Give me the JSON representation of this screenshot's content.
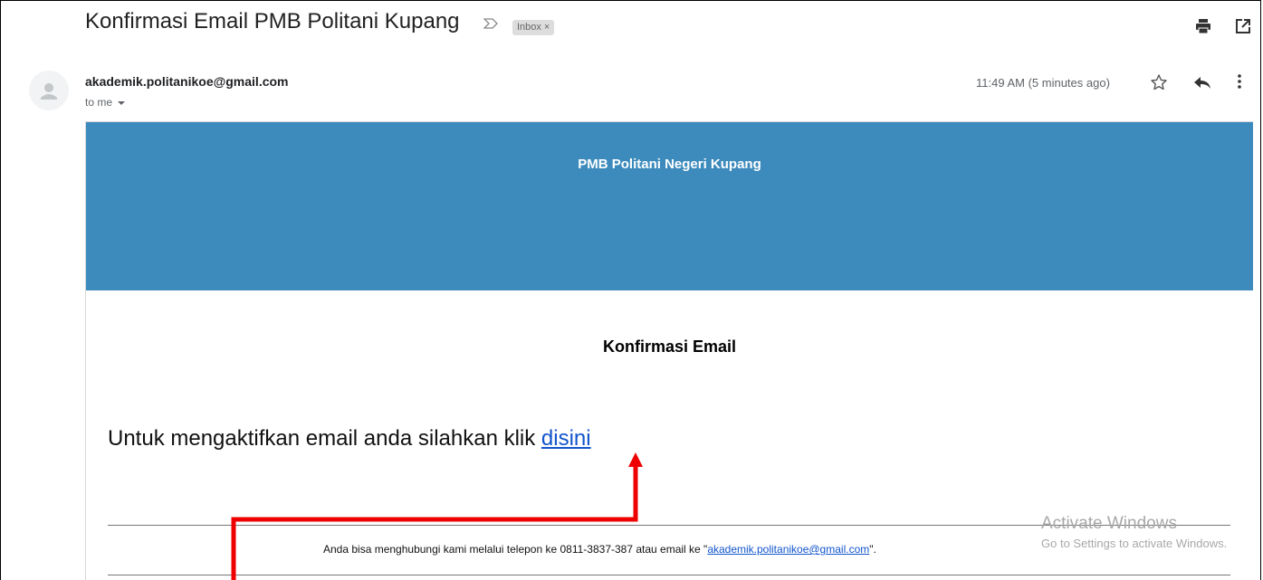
{
  "header": {
    "subject": "Konfirmasi Email PMB Politani Kupang",
    "label": "Inbox",
    "label_remove": "×"
  },
  "sender": {
    "email": "akademik.politanikoe@gmail.com",
    "to": "to me",
    "timestamp": "11:49 AM (5 minutes ago)"
  },
  "email": {
    "banner_title": "PMB Politani Negeri Kupang",
    "heading": "Konfirmasi Email",
    "message": "Untuk mengaktifkan email anda silahkan klik ",
    "link_text": "disini",
    "contact_prefix": "Anda bisa menghubungi kami melalui telepon ke 0811-3837-387 atau email ke \"",
    "contact_email": "akademik.politanikoe@gmail.com",
    "contact_suffix": "\"."
  },
  "watermark": {
    "line1": "Activate Windows",
    "line2": "Go to Settings to activate Windows."
  },
  "icons": {
    "important": "important-marker-icon",
    "print": "print-icon",
    "new_window": "open-in-new-window-icon",
    "avatar": "default-avatar-icon",
    "star": "star-icon",
    "reply": "reply-icon",
    "more": "more-vertical-icon"
  },
  "colors": {
    "banner": "#3d8bbd",
    "link": "#1155cc",
    "annotation_arrow": "#ee0000",
    "label_chip": "#dddddd"
  }
}
